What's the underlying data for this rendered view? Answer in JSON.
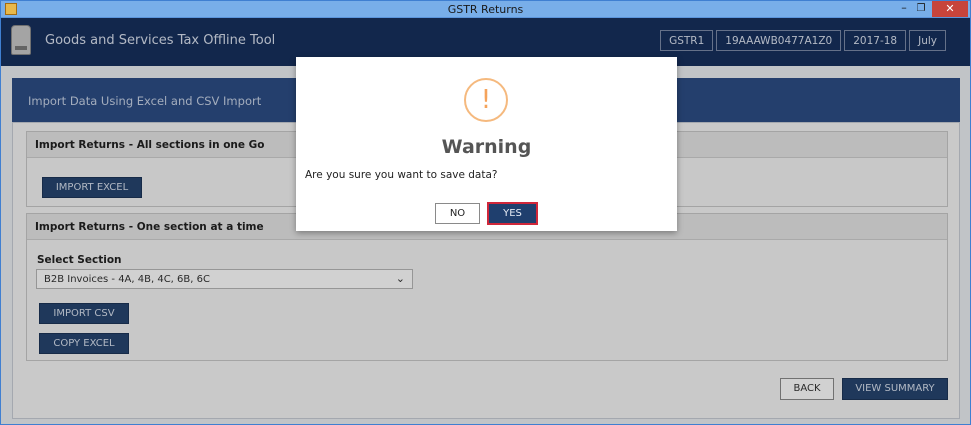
{
  "window": {
    "title": "GSTR Returns",
    "minimize": "–",
    "maximize": "❐",
    "close": "✕"
  },
  "header": {
    "app_title": "Goods and Services Tax Offline Tool",
    "chips": [
      "GSTR1",
      "19AAAWB0477A1Z0",
      "2017-18",
      "July"
    ]
  },
  "page": {
    "title": "Import Data Using Excel and CSV Import"
  },
  "panel_all": {
    "heading": "Import Returns - All sections in one Go",
    "import_excel": "IMPORT EXCEL"
  },
  "panel_one": {
    "heading": "Import Returns - One section at a time",
    "select_label": "Select Section",
    "select_value": "B2B Invoices - 4A, 4B, 4C, 6B, 6C",
    "import_csv": "IMPORT CSV",
    "copy_excel": "COPY EXCEL"
  },
  "footer": {
    "back": "BACK",
    "view_summary": "VIEW SUMMARY"
  },
  "dialog": {
    "icon": "!",
    "title": "Warning",
    "message": "Are you sure you want to save data?",
    "no": "NO",
    "yes": "YES"
  },
  "colors": {
    "header_bg": "#17305d",
    "page_head_bg": "#2d4d85",
    "button_dark": "#27456f",
    "warning_icon": "#f5b97e",
    "yes_border": "#d0273a"
  }
}
